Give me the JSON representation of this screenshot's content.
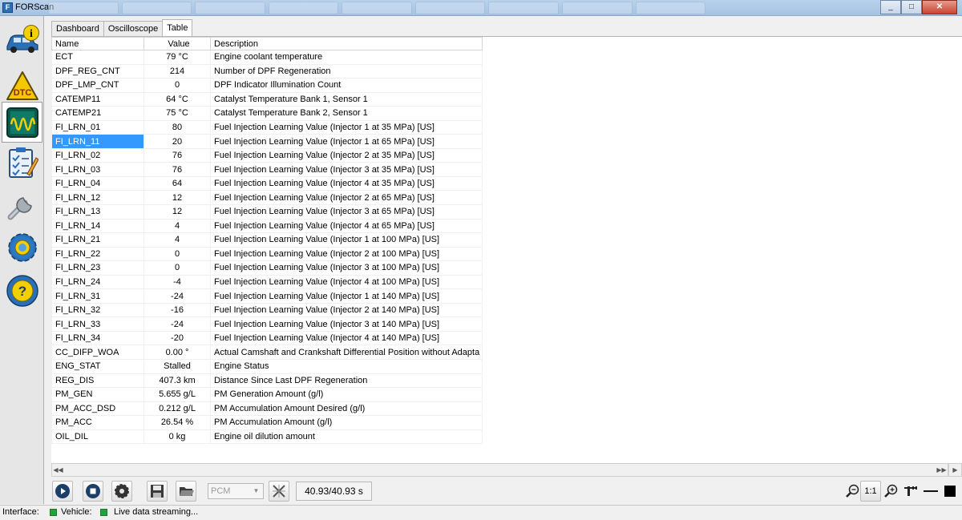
{
  "window": {
    "title": "FORScan",
    "minimize": "_",
    "maximize": "□",
    "close": "✕"
  },
  "sidebar": {
    "items": [
      {
        "name": "info",
        "icon": "car-info-icon"
      },
      {
        "name": "dtc",
        "icon": "dtc-warning-icon",
        "label": "DTC"
      },
      {
        "name": "oscilloscope",
        "icon": "oscilloscope-icon"
      },
      {
        "name": "tests",
        "icon": "checklist-icon"
      },
      {
        "name": "service",
        "icon": "wrench-icon"
      },
      {
        "name": "configuration",
        "icon": "gear-icon"
      },
      {
        "name": "help",
        "icon": "help-icon"
      }
    ]
  },
  "tabs": [
    {
      "label": "Dashboard",
      "active": false
    },
    {
      "label": "Oscilloscope",
      "active": false
    },
    {
      "label": "Table",
      "active": true
    }
  ],
  "table": {
    "headers": [
      "Name",
      "Value",
      "Description"
    ],
    "selected_row": 6,
    "rows": [
      [
        "ECT",
        "79 °C",
        "Engine coolant temperature"
      ],
      [
        "DPF_REG_CNT",
        "214",
        "Number of DPF Regeneration"
      ],
      [
        "DPF_LMP_CNT",
        "0",
        "DPF Indicator Illumination Count"
      ],
      [
        "CATEMP11",
        "64 °C",
        "Catalyst Temperature Bank 1, Sensor 1"
      ],
      [
        "CATEMP21",
        "75 °C",
        "Catalyst Temperature Bank 2, Sensor 1"
      ],
      [
        "FI_LRN_01",
        "80",
        "Fuel Injection Learning Value (Injector 1 at 35  MPa) [US]"
      ],
      [
        "FI_LRN_11",
        "20",
        "Fuel Injection Learning Value (Injector 1 at 65  MPa) [US]"
      ],
      [
        "FI_LRN_02",
        "76",
        "Fuel Injection Learning Value (Injector 2 at 35  MPa) [US]"
      ],
      [
        "FI_LRN_03",
        "76",
        "Fuel Injection Learning Value (Injector 3 at 35  MPa) [US]"
      ],
      [
        "FI_LRN_04",
        "64",
        "Fuel Injection Learning Value (Injector 4 at 35  MPa) [US]"
      ],
      [
        "FI_LRN_12",
        "12",
        "Fuel Injection Learning Value (Injector 2 at 65  MPa) [US]"
      ],
      [
        "FI_LRN_13",
        "12",
        "Fuel Injection Learning Value (Injector 3 at 65  MPa) [US]"
      ],
      [
        "FI_LRN_14",
        "4",
        "Fuel Injection Learning Value (Injector 4 at 65  MPa) [US]"
      ],
      [
        "FI_LRN_21",
        "4",
        "Fuel Injection Learning Value (Injector 1 at 100  MPa) [US]"
      ],
      [
        "FI_LRN_22",
        "0",
        "Fuel Injection Learning Value (Injector 2 at 100  MPa) [US]"
      ],
      [
        "FI_LRN_23",
        "0",
        "Fuel Injection Learning Value (Injector 3 at 100  MPa) [US]"
      ],
      [
        "FI_LRN_24",
        "-4",
        "Fuel Injection Learning Value (Injector 4 at 100  MPa) [US]"
      ],
      [
        "FI_LRN_31",
        "-24",
        "Fuel Injection Learning Value (Injector 1 at 140  MPa) [US]"
      ],
      [
        "FI_LRN_32",
        "-16",
        "Fuel Injection Learning Value (Injector 2 at 140  MPa) [US]"
      ],
      [
        "FI_LRN_33",
        "-24",
        "Fuel Injection Learning Value (Injector 3 at 140  MPa) [US]"
      ],
      [
        "FI_LRN_34",
        "-20",
        "Fuel Injection Learning Value (Injector 4 at 140  MPa) [US]"
      ],
      [
        "CC_DIFP_WOA",
        "0.00 °",
        "Actual Camshaft and Crankshaft Differential Position without Adapta"
      ],
      [
        "ENG_STAT",
        "Stalled",
        "Engine Status"
      ],
      [
        "REG_DIS",
        "407.3 km",
        "Distance Since Last DPF Regeneration"
      ],
      [
        "PM_GEN",
        "5.655 g/L",
        "PM Generation Amount (g/l)"
      ],
      [
        "PM_ACC_DSD",
        "0.212 g/L",
        "PM Accumulation Amount Desired (g/l)"
      ],
      [
        "PM_ACC",
        "26.54 %",
        "PM Accumulation Amount (g/l)"
      ],
      [
        "OIL_DIL",
        "0 kg",
        "Engine oil dilution amount"
      ]
    ]
  },
  "scrollbar": {
    "left_arrows": "◀◀",
    "right_arrows": "▶▶"
  },
  "toolbar": {
    "module_select": "PCM",
    "time": "40.93/40.93 s",
    "zoom_ratio": "1:1",
    "buttons": [
      "play-icon",
      "stop-icon",
      "settings-icon",
      "save-icon",
      "open-folder-icon",
      "reset-icon",
      "zoom-out-icon",
      "zoom-in-icon",
      "crop-icon",
      "line-icon",
      "fill-icon"
    ]
  },
  "status": {
    "interface_label": "Interface:",
    "vehicle_label": "Vehicle:",
    "message": "Live data streaming...",
    "ok_color": "#22a33a"
  },
  "colors": {
    "selection": "#3399ff",
    "accent": "#2a6fb8"
  }
}
